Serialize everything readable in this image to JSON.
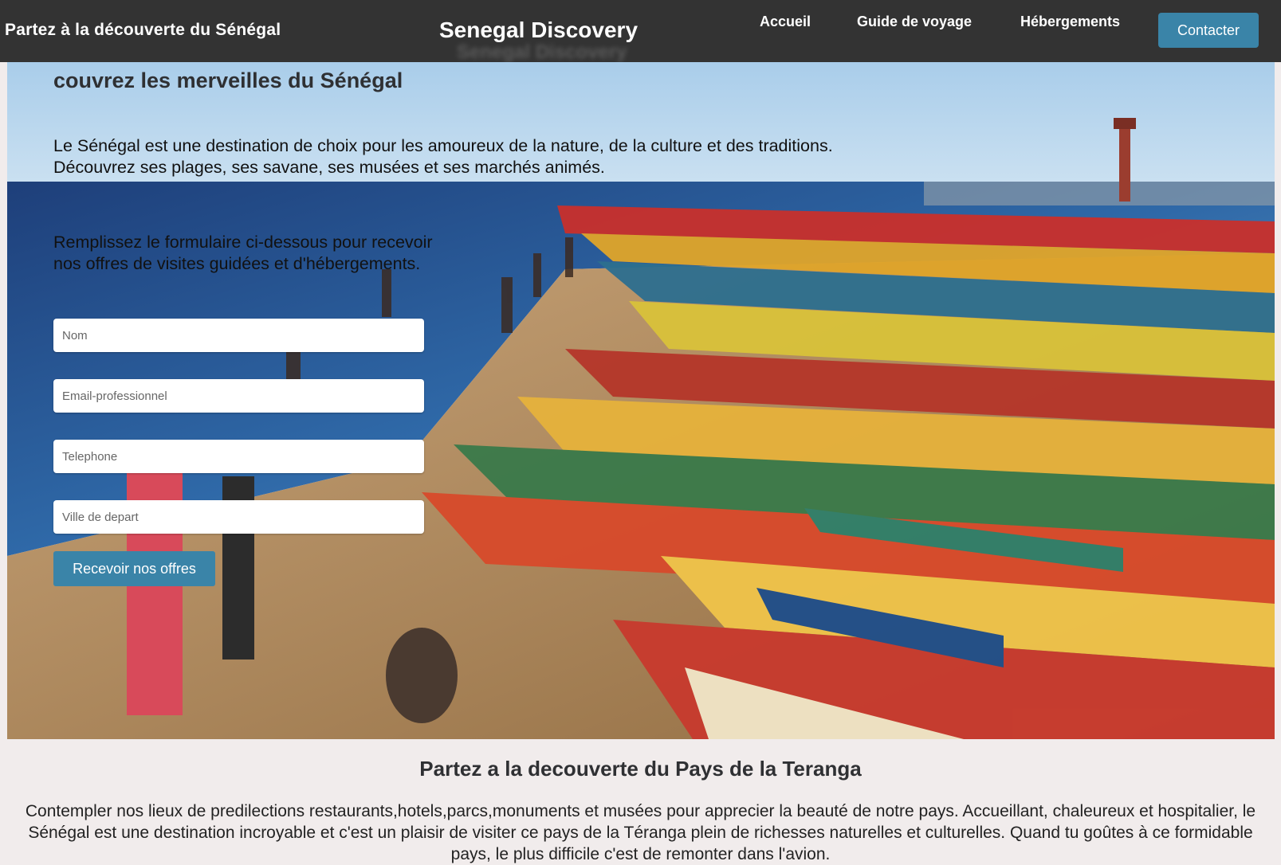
{
  "header": {
    "tagline": "Partez à la découverte du Sénégal",
    "brand": "Senegal Discovery",
    "nav": {
      "home": "Accueil",
      "guide": "Guide de voyage",
      "lodging": "Hébergements"
    },
    "contact_label": "Contacter"
  },
  "hero": {
    "title": "couvrez les merveilles du Sénégal",
    "lead_line1": "Le Sénégal est une destination de choix pour les amoureux de la nature, de la culture et des traditions.",
    "lead_line2": "Découvrez ses plages, ses savane, ses musées et ses marchés animés.",
    "form_intro_line1": "Remplissez le formulaire ci-dessous pour recevoir",
    "form_intro_line2": "nos offres de visites guidées et d'hébergements.",
    "form": {
      "name_placeholder": "Nom",
      "email_placeholder": "Email-professionnel",
      "phone_placeholder": "Telephone",
      "city_placeholder": "Ville de depart",
      "submit_label": "Recevoir nos offres"
    }
  },
  "section": {
    "title": "Partez a la decouverte du Pays de la Teranga",
    "paragraph": "Contempler nos lieux de predilections restaurants,hotels,parcs,monuments et musées pour apprecier la beauté de notre pays. Accueillant, chaleureux et hospitalier, le Sénégal est une destination incroyable et c'est un plaisir de visiter ce pays de la Téranga plein de richesses naturelles et culturelles. Quand tu goûtes à ce formidable pays, le plus difficile c'est de remonter dans l'avion."
  },
  "colors": {
    "header_bg": "#333333",
    "accent_button": "#3a84a8",
    "page_bg": "#f1ecec"
  }
}
